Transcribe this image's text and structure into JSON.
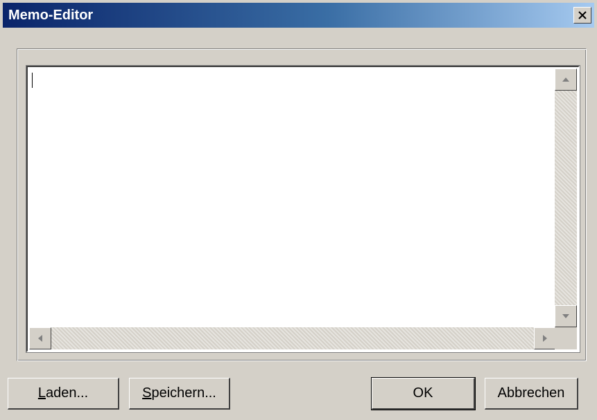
{
  "window": {
    "title": "Memo-Editor"
  },
  "memo": {
    "value": ""
  },
  "buttons": {
    "load": {
      "accel": "L",
      "rest": "aden..."
    },
    "save": {
      "accel": "S",
      "rest": "peichern..."
    },
    "ok": "OK",
    "cancel": "Abbrechen"
  }
}
